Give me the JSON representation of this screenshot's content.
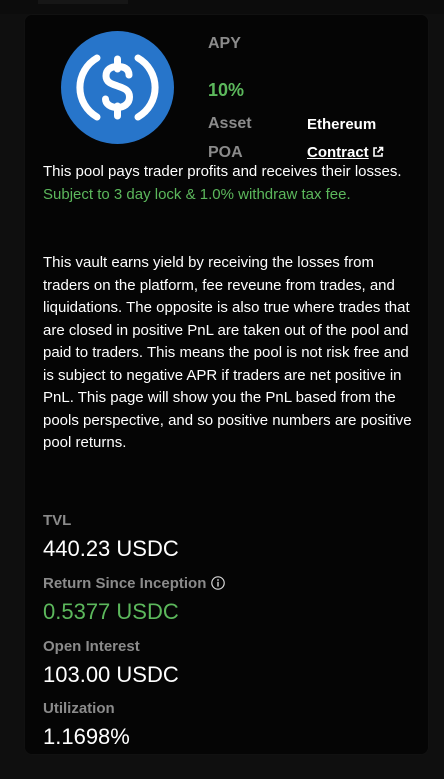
{
  "pool": {
    "apy_label": "APY",
    "apy_value": "10%",
    "asset_label": "Asset",
    "asset_value": "Ethereum",
    "poa_label": "POA",
    "poa_link": "Contract",
    "logo_icon": "usdc-coin-icon",
    "colors": {
      "accent_green": "#5cb85c",
      "logo_blue": "#2775ca",
      "label_gray": "#8b8b8b"
    }
  },
  "description": {
    "intro": "This pool pays trader profits and receives their losses.",
    "terms": "Subject to 3 day lock & 1.0% withdraw tax fee.",
    "details": "This vault earns yield by receiving the losses from traders on the platform, fee reveune from trades, and liquidations. The opposite is also true where trades that are closed in positive PnL are taken out of the pool and paid to traders. This means the pool is not risk free and is subject to negative APR if traders are net positive in PnL. This page will show you the PnL based from the pools perspective, and so positive numbers are positive pool returns."
  },
  "stats": {
    "tvl_label": "TVL",
    "tvl_value": "440.23 USDC",
    "return_label": "Return Since Inception",
    "return_value": "0.5377 USDC",
    "open_interest_label": "Open Interest",
    "open_interest_value": "103.00 USDC",
    "utilization_label": "Utilization",
    "utilization_value": "1.1698%"
  }
}
